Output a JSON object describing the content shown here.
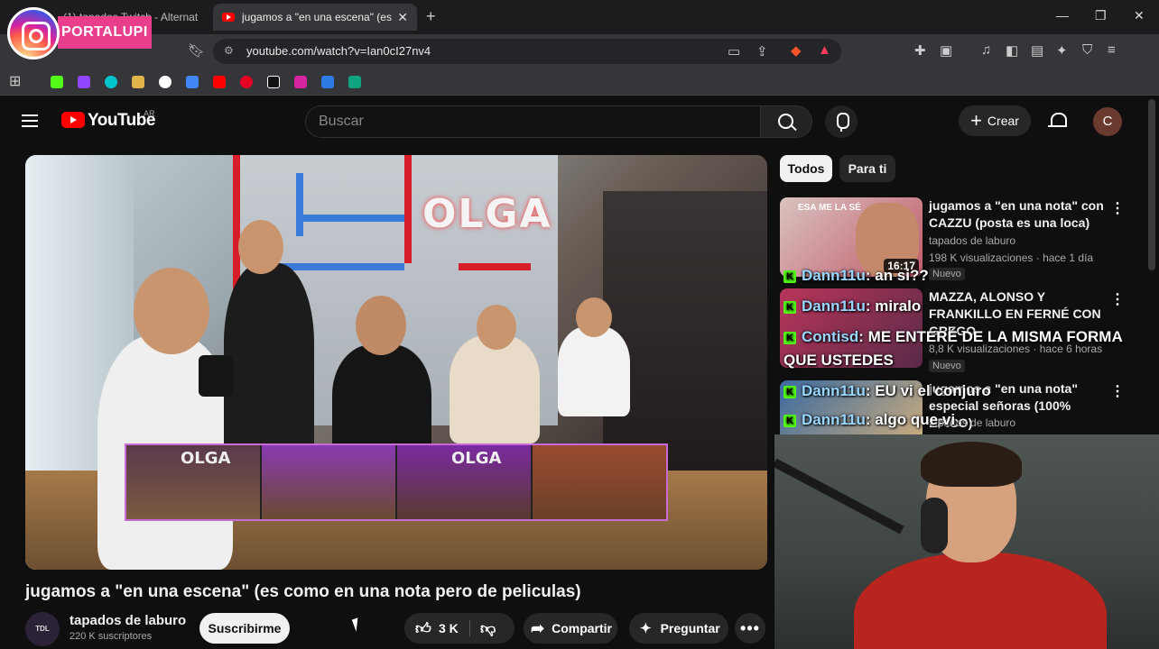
{
  "browser": {
    "tabs": [
      {
        "label": "(1) tapados Twitch - Alternat"
      },
      {
        "label": "jugamos a \"en una escena\" (es c"
      }
    ],
    "url": "youtube.com/watch?v=Ian0cI27nv4",
    "window_controls": [
      "—",
      "❐",
      "✕"
    ]
  },
  "watermark": {
    "label": "PORTALUPI"
  },
  "youtube": {
    "logo_text": "YouTube",
    "region": "AR",
    "search_placeholder": "Buscar",
    "create_label": "Crear",
    "avatar_letter": "C"
  },
  "video": {
    "title": "jugamos a \"en una escena\" (es como en una nota pero de peliculas)",
    "sign_text": "OLGA",
    "strip_labels": [
      "OLGA",
      "",
      "OLGA",
      ""
    ],
    "channel": {
      "avatar_text": "TDL",
      "name": "tapados de laburo",
      "subscribers": "220 K suscriptores",
      "subscribe_label": "Suscribirme"
    },
    "actions": {
      "likes": "3 K",
      "share_label": "Compartir",
      "ask_label": "Preguntar"
    }
  },
  "sidebar": {
    "chips": [
      "Todos",
      "Para ti"
    ],
    "recommendations": [
      {
        "title": "jugamos a \"en una nota\" con CAZZU (posta es una loca)",
        "channel": "tapados de laburo",
        "meta": "198 K visualizaciones · hace 1 día",
        "badge": "Nuevo",
        "duration": "16:17",
        "thumb_text": "ESA ME LA SÉ"
      },
      {
        "title": "MAZZA, ALONSO Y FRANKILLO EN FERNÉ CON GREGO",
        "channel": "",
        "meta": "8,8 K visualizaciones · hace 6 horas",
        "badge": "Nuevo",
        "duration": "",
        "thumb_text": ""
      },
      {
        "title": "jugamos a \"en una nota\" especial señoras (100% ÉPICO)",
        "channel": "tapados de laburo",
        "meta": "",
        "badge": "",
        "duration": "",
        "thumb_text": ""
      }
    ]
  },
  "chat_overlay": [
    {
      "user": "Dann11u",
      "text": ": an si??"
    },
    {
      "user": "Dann11u",
      "text": ": miralo"
    },
    {
      "user": "Contisd",
      "text": ": ME ENTERÉ DE LA MISMA FORMA"
    },
    {
      "user": "",
      "text": "QUE USTEDES"
    },
    {
      "user": "Dann11u",
      "text": ": EU vi el conjuro"
    },
    {
      "user": "Dann11u",
      "text": ": algo que vi"
    }
  ],
  "colors": {
    "background": "#0f0f0f",
    "youtube_red": "#ff0000",
    "kick_green": "#53fc18",
    "watermark_pink": "#e83e8c"
  }
}
